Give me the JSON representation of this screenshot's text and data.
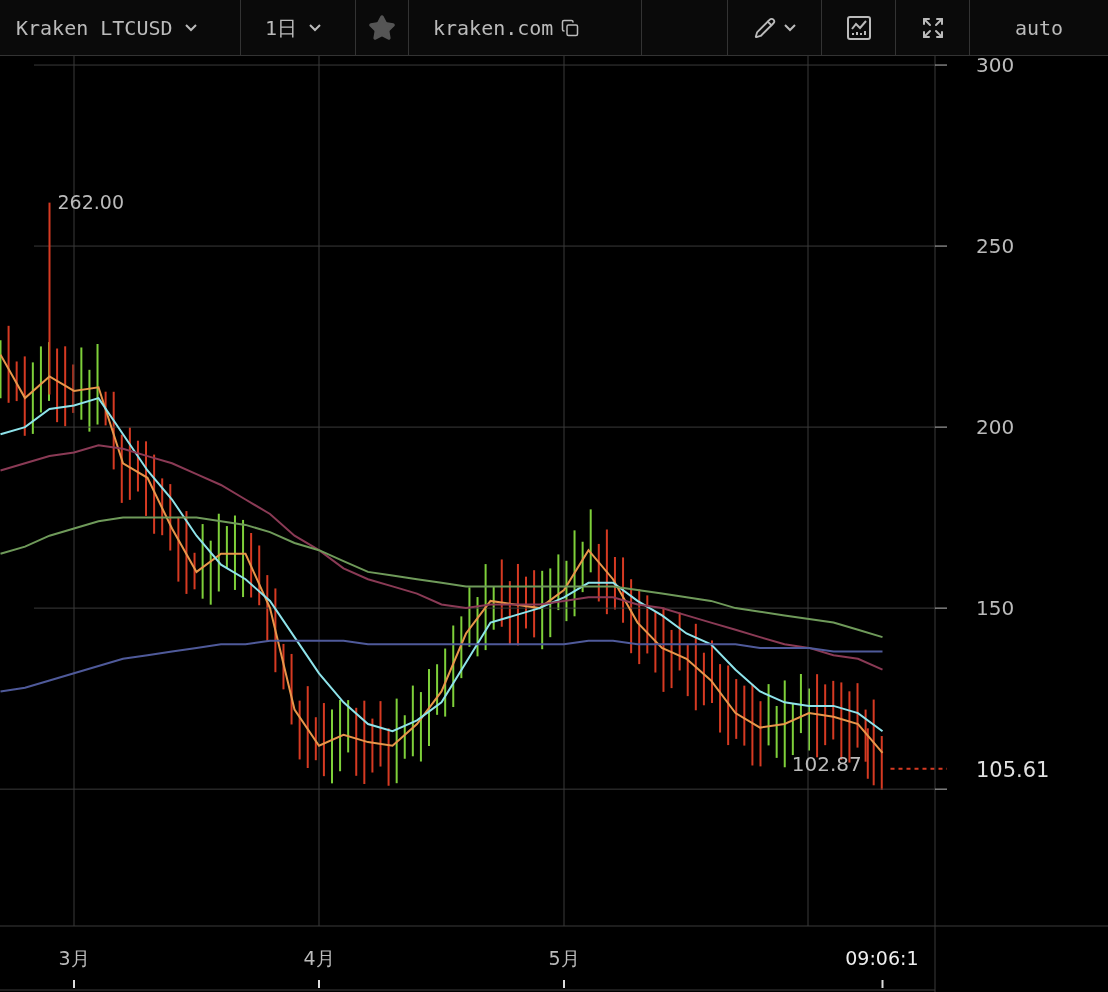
{
  "toolbar": {
    "symbol": "Kraken LTCUSD",
    "interval": "1日",
    "site": "kraken.com",
    "scale_mode": "auto"
  },
  "chart": {
    "chart_data": {
      "type": "line",
      "categories": [
        null,
        null,
        null,
        "3月",
        null,
        null,
        null,
        null,
        null,
        null,
        null,
        null,
        null,
        "4月",
        null,
        null,
        null,
        null,
        null,
        null,
        null,
        null,
        null,
        "5月",
        null,
        null,
        null,
        null,
        null,
        null,
        null,
        null,
        null,
        null,
        null,
        null,
        "09:06:1"
      ],
      "series": [
        {
          "color": "#e8964a",
          "values": [
            220,
            208,
            214,
            210,
            211,
            190,
            186,
            172,
            160,
            165,
            165,
            150,
            122,
            112,
            115,
            113,
            112,
            118,
            127,
            143,
            152,
            151,
            150,
            155,
            166,
            158,
            146,
            139,
            136,
            130,
            121,
            117,
            118,
            121,
            120,
            118,
            110
          ]
        },
        {
          "color": "#8ee3ea",
          "values": [
            198,
            200,
            205,
            206,
            208,
            198,
            188,
            180,
            170,
            162,
            158,
            152,
            142,
            132,
            124,
            118,
            116,
            119,
            124,
            135,
            146,
            148,
            150,
            153,
            157,
            157,
            152,
            148,
            143,
            140,
            133,
            127,
            124,
            123,
            123,
            121,
            116
          ]
        },
        {
          "color": "#8a3a55",
          "values": [
            188,
            190,
            192,
            193,
            195,
            194,
            192,
            190,
            187,
            184,
            180,
            176,
            170,
            166,
            161,
            158,
            156,
            154,
            151,
            150,
            151,
            151,
            151,
            152,
            153,
            153,
            151,
            150,
            148,
            146,
            144,
            142,
            140,
            139,
            137,
            136,
            133
          ]
        },
        {
          "color": "#6f9a5a",
          "values": [
            165,
            167,
            170,
            172,
            174,
            175,
            175,
            175,
            175,
            174,
            173,
            171,
            168,
            166,
            163,
            160,
            159,
            158,
            157,
            156,
            156,
            156,
            156,
            156,
            156,
            156,
            155,
            154,
            153,
            152,
            150,
            149,
            148,
            147,
            146,
            144,
            142
          ]
        },
        {
          "color": "#4f5a9a",
          "values": [
            127,
            128,
            130,
            132,
            134,
            136,
            137,
            138,
            139,
            140,
            140,
            141,
            141,
            141,
            141,
            140,
            140,
            140,
            140,
            140,
            140,
            140,
            140,
            140,
            141,
            141,
            140,
            140,
            140,
            140,
            140,
            139,
            139,
            139,
            138,
            138,
            138
          ]
        }
      ],
      "grid": true,
      "ylim": [
        62.2,
        302.5
      ],
      "yticks": [
        150,
        200,
        250,
        300
      ],
      "annotations": [
        "262.00",
        "102.87",
        "105.61"
      ]
    }
  }
}
